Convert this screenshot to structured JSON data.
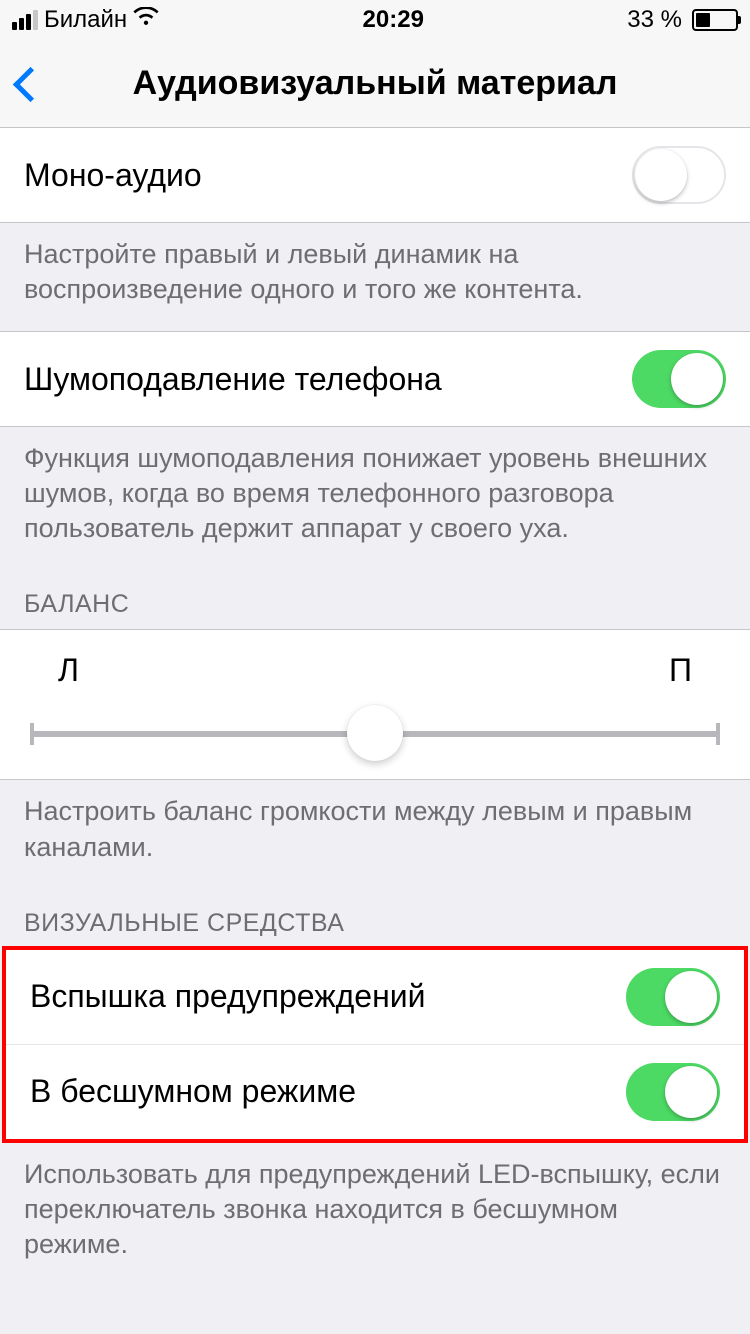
{
  "statusBar": {
    "carrier": "Билайн",
    "time": "20:29",
    "batteryText": "33 %"
  },
  "nav": {
    "title": "Аудиовизуальный материал"
  },
  "monoAudio": {
    "label": "Моно-аудио",
    "on": false,
    "footer": "Настройте правый и левый динамик на воспроизведение одного и того же контента."
  },
  "noiseCancel": {
    "label": "Шумоподавление телефона",
    "on": true,
    "footer": "Функция шумоподавления понижает уровень внешних шумов, когда во время телефонного разговора пользователь держит аппарат у своего уха."
  },
  "balance": {
    "header": "БАЛАНС",
    "leftLabel": "Л",
    "rightLabel": "П",
    "value": 0.5,
    "footer": "Настроить баланс громкости между левым и правым каналами."
  },
  "visual": {
    "header": "ВИЗУАЛЬНЫЕ СРЕДСТВА",
    "flashAlerts": {
      "label": "Вспышка предупреждений",
      "on": true
    },
    "flashOnSilent": {
      "label": "В бесшумном режиме",
      "on": true
    },
    "footer": "Использовать для предупреждений LED-вспышку, если переключатель звонка находится в бесшумном режиме."
  }
}
